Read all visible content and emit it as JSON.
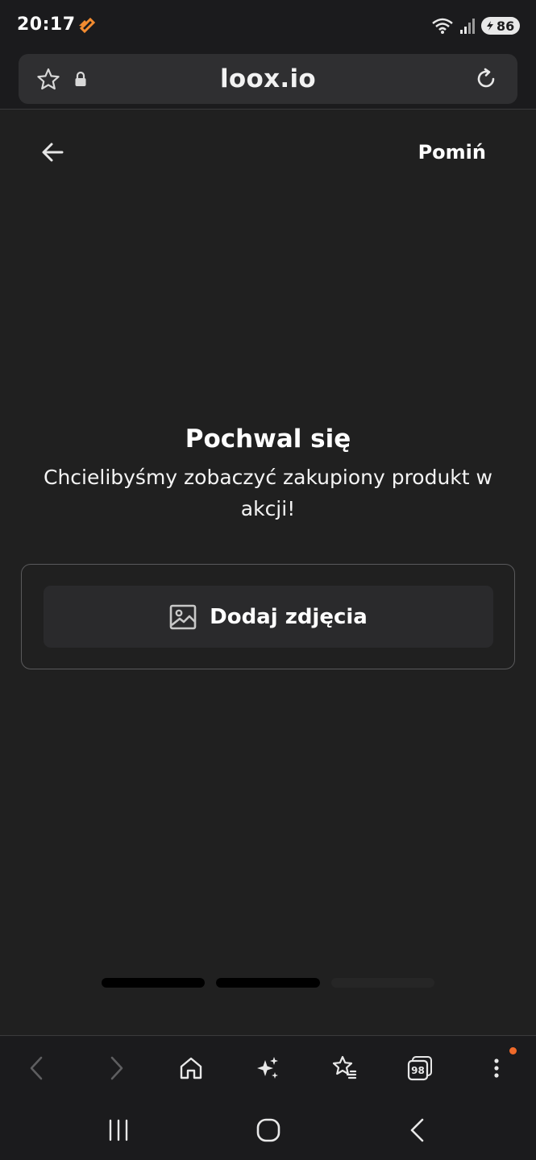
{
  "status_bar": {
    "time": "20:17",
    "battery_level": "86",
    "icons": [
      "notification-app-icon",
      "wifi-icon",
      "signal-icon",
      "battery-icon"
    ]
  },
  "browser": {
    "url": "loox.io",
    "icons": [
      "star-icon",
      "lock-icon",
      "reload-icon"
    ]
  },
  "page": {
    "skip_label": "Pomiń",
    "title": "Pochwal się",
    "subtitle": "Chcielibyśmy zobaczyć zakupiony produkt w akcji!",
    "add_photos_label": "Dodaj zdjęcia",
    "progress": {
      "total_steps": 3,
      "completed_steps": 2
    }
  },
  "toolbar": {
    "tabs_count": "98",
    "has_notification": true,
    "icons": [
      "back-icon",
      "forward-icon",
      "home-icon",
      "sparkle-icon",
      "bookmarks-icon",
      "tabs-icon",
      "more-icon"
    ]
  },
  "colors": {
    "background": "#202020",
    "bar_background": "#1b1b1d",
    "progress_active": "#000000",
    "progress_inactive": "#262626",
    "notification": "#f06a2a",
    "app_icon": "#f28b30"
  }
}
